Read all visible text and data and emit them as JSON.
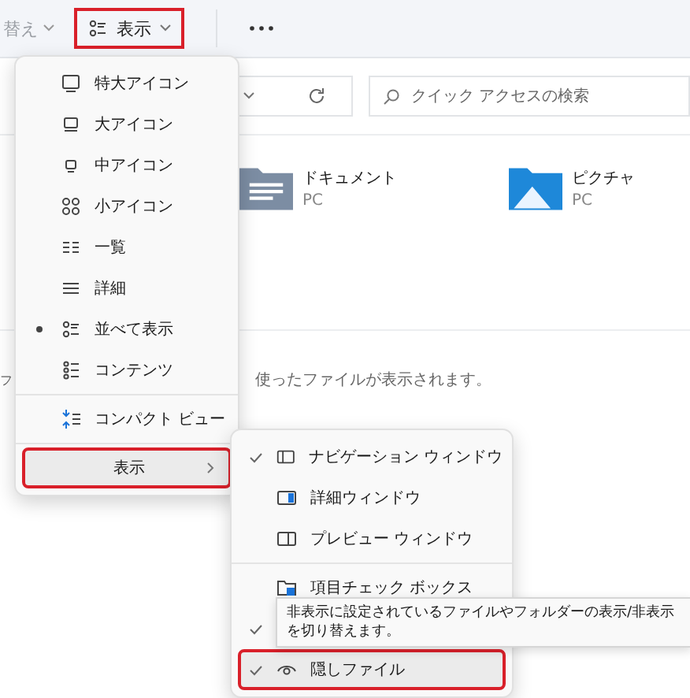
{
  "toolbar": {
    "sort_label": "替え",
    "view_button": {
      "label": "表示",
      "highlighted": true
    }
  },
  "address_bar": {
    "search": {
      "placeholder": "クイック アクセスの検索"
    }
  },
  "quick_access": [
    {
      "name": "ドキュメント",
      "location": "PC"
    },
    {
      "name": "ピクチャ",
      "location": "PC"
    }
  ],
  "recent_hint": [
    "フ",
    "使ったファイルが表示されます。"
  ],
  "view_menu": {
    "groups": [
      [
        {
          "label": "特大アイコン",
          "selected": false
        },
        {
          "label": "大アイコン",
          "selected": false
        },
        {
          "label": "中アイコン",
          "selected": false
        },
        {
          "label": "小アイコン",
          "selected": false
        },
        {
          "label": "一覧",
          "selected": false
        },
        {
          "label": "詳細",
          "selected": false
        },
        {
          "label": "並べて表示",
          "selected": true
        },
        {
          "label": "コンテンツ",
          "selected": false
        }
      ],
      [
        {
          "label": "コンパクト ビュー",
          "selected": false
        }
      ],
      [
        {
          "label": "表示",
          "highlighted": true
        }
      ]
    ]
  },
  "show_submenu": {
    "groups": [
      [
        {
          "label": "ナビゲーション ウィンドウ",
          "checked": true,
          "highlighted": false
        },
        {
          "label": "詳細ウィンドウ",
          "checked": false,
          "highlighted": false
        },
        {
          "label": "プレビュー ウィンドウ",
          "checked": false,
          "highlighted": false
        }
      ],
      [
        {
          "label": "項目チェック ボックス",
          "checked": false,
          "highlighted": false
        },
        {
          "checked": true,
          "highlighted": false
        },
        {
          "label": "隠しファイル",
          "checked": true,
          "highlighted": true
        }
      ]
    ]
  },
  "tooltip": "非表示に設定されているファイルやフォルダーの表示/非表示を切り替えます。"
}
